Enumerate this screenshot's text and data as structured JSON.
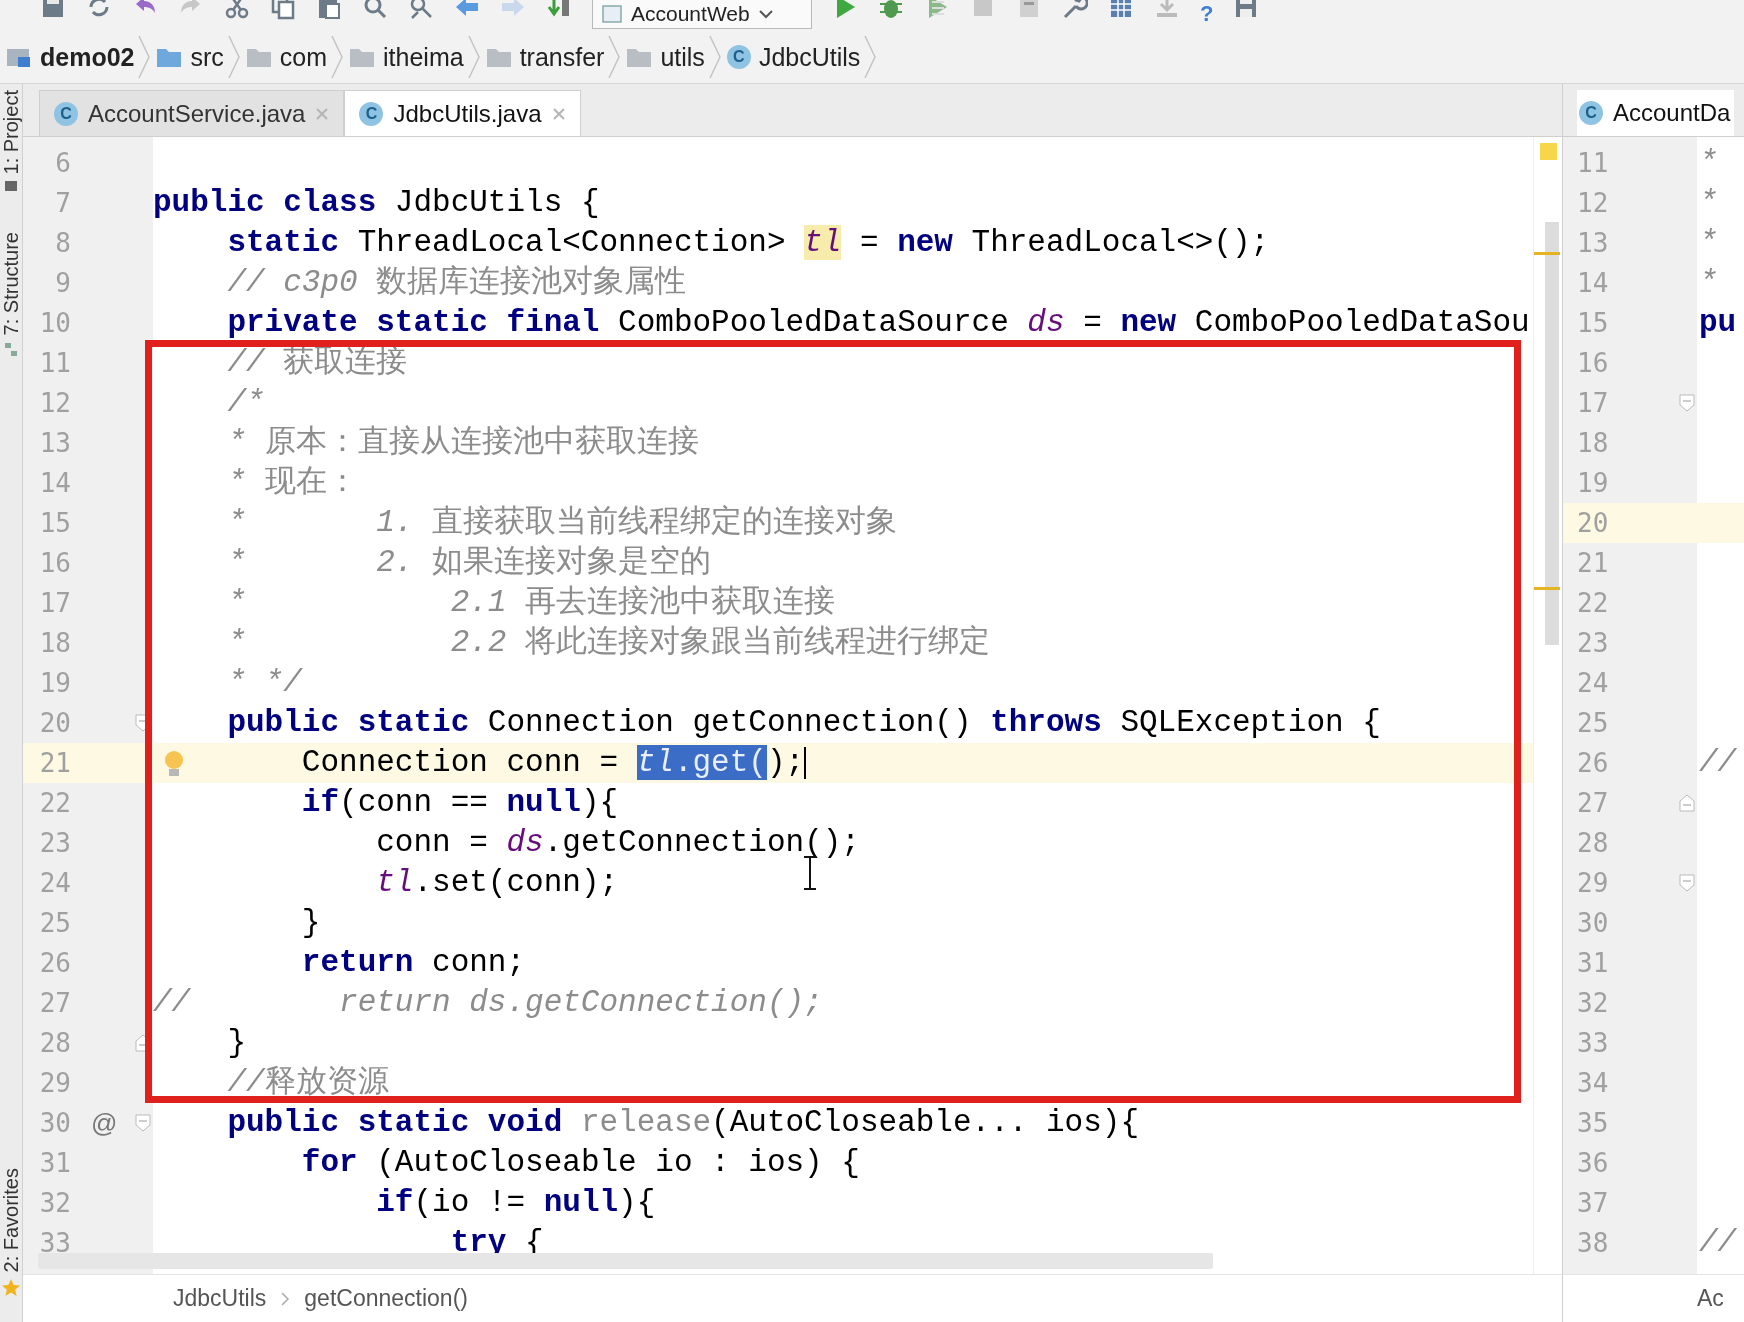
{
  "toolbar": {
    "run_config": "AccountWeb",
    "help": "?"
  },
  "navbar": {
    "items": [
      {
        "label": "demo02",
        "kind": "module"
      },
      {
        "label": "src",
        "kind": "source"
      },
      {
        "label": "com",
        "kind": "folder"
      },
      {
        "label": "itheima",
        "kind": "folder"
      },
      {
        "label": "transfer",
        "kind": "folder"
      },
      {
        "label": "utils",
        "kind": "folder"
      },
      {
        "label": "JdbcUtils",
        "kind": "class",
        "icon_letter": "C"
      }
    ]
  },
  "tool_strip": {
    "labels": [
      "1: Project",
      "7: Structure",
      "2: Favorites"
    ]
  },
  "editor": {
    "tabs": [
      {
        "label": "AccountService.java",
        "icon_letter": "C",
        "selected": false
      },
      {
        "label": "JdbcUtils.java",
        "icon_letter": "C",
        "selected": true
      }
    ],
    "lines": [
      {
        "number": "6",
        "current": false
      },
      {
        "number": "7",
        "current": false,
        "tokens": [
          {
            "text": "public class",
            "kind": "kw"
          },
          {
            "text": " JdbcUtils {",
            "kind": "plain"
          }
        ]
      },
      {
        "number": "8",
        "current": false,
        "tokens": [
          {
            "text": "    static",
            "kind": "kw"
          },
          {
            "text": " ThreadLocal<Connection> ",
            "kind": "plain"
          },
          {
            "text": "tl",
            "kind": "usage"
          },
          {
            "text": " = ",
            "kind": "plain"
          },
          {
            "text": "new",
            "kind": "kw"
          },
          {
            "text": " ThreadLocal<>();",
            "kind": "plain"
          }
        ]
      },
      {
        "number": "9",
        "current": false,
        "tokens": [
          {
            "text": "    // c3p0 ",
            "kind": "comment"
          },
          {
            "text": "数据库连接池对象属性",
            "kind": "remark"
          }
        ]
      },
      {
        "number": "10",
        "current": false,
        "tokens": [
          {
            "text": "    private static final",
            "kind": "kw"
          },
          {
            "text": " ComboPooledDataSource ",
            "kind": "plain"
          },
          {
            "text": "ds",
            "kind": "field"
          },
          {
            "text": " = ",
            "kind": "plain"
          },
          {
            "text": "new",
            "kind": "kw"
          },
          {
            "text": " ComboPooledDataSou",
            "kind": "plain"
          }
        ]
      },
      {
        "number": "11",
        "current": false,
        "tokens": [
          {
            "text": "    // ",
            "kind": "comment"
          },
          {
            "text": "获取连接",
            "kind": "remark"
          }
        ]
      },
      {
        "number": "12",
        "current": false,
        "tokens": [
          {
            "text": "    /*",
            "kind": "comment"
          }
        ]
      },
      {
        "number": "13",
        "current": false,
        "tokens": [
          {
            "text": "    * ",
            "kind": "comment"
          },
          {
            "text": "原本：直接从连接池中获取连接",
            "kind": "remark"
          }
        ]
      },
      {
        "number": "14",
        "current": false,
        "tokens": [
          {
            "text": "    * ",
            "kind": "comment"
          },
          {
            "text": "现在：",
            "kind": "remark"
          }
        ]
      },
      {
        "number": "15",
        "current": false,
        "tokens": [
          {
            "text": "    *       1. ",
            "kind": "comment"
          },
          {
            "text": "直接获取当前线程绑定的连接对象",
            "kind": "remark"
          }
        ]
      },
      {
        "number": "16",
        "current": false,
        "tokens": [
          {
            "text": "    *       2. ",
            "kind": "comment"
          },
          {
            "text": "如果连接对象是空的",
            "kind": "remark"
          }
        ]
      },
      {
        "number": "17",
        "current": false,
        "tokens": [
          {
            "text": "    *           2.1 ",
            "kind": "comment"
          },
          {
            "text": "再去连接池中获取连接",
            "kind": "remark"
          }
        ]
      },
      {
        "number": "18",
        "current": false,
        "tokens": [
          {
            "text": "    *           2.2 ",
            "kind": "comment"
          },
          {
            "text": "将此连接对象跟当前线程进行绑定",
            "kind": "remark"
          }
        ]
      },
      {
        "number": "19",
        "current": false,
        "tokens": [
          {
            "text": "    * */",
            "kind": "comment"
          }
        ]
      },
      {
        "number": "20",
        "current": false,
        "kind": "fold",
        "tokens": [
          {
            "text": "    public static",
            "kind": "kw"
          },
          {
            "text": " Connection getConnection() ",
            "kind": "plain"
          },
          {
            "text": "throws",
            "kind": "kw"
          },
          {
            "text": " SQLException {",
            "kind": "plain"
          }
        ]
      },
      {
        "number": "21",
        "current": true,
        "kind": "bulb",
        "tokens": [
          {
            "text": "        Connection conn = ",
            "kind": "plain"
          },
          {
            "text": "tl",
            "kind": "selfield"
          },
          {
            "text": ".get(",
            "kind": "selplain"
          },
          {
            "text": ");",
            "kind": "plain"
          }
        ]
      },
      {
        "number": "22",
        "current": false,
        "tokens": [
          {
            "text": "        if",
            "kind": "kw"
          },
          {
            "text": "(conn == ",
            "kind": "plain"
          },
          {
            "text": "null",
            "kind": "kw"
          },
          {
            "text": "){",
            "kind": "plain"
          }
        ]
      },
      {
        "number": "23",
        "current": false,
        "tokens": [
          {
            "text": "            conn = ",
            "kind": "plain"
          },
          {
            "text": "ds",
            "kind": "field"
          },
          {
            "text": ".getConnection();",
            "kind": "plain"
          }
        ]
      },
      {
        "number": "24",
        "current": false,
        "tokens": [
          {
            "text": "            tl",
            "kind": "field"
          },
          {
            "text": ".set(conn);",
            "kind": "plain"
          }
        ]
      },
      {
        "number": "25",
        "current": false,
        "tokens": [
          {
            "text": "        }",
            "kind": "plain"
          }
        ]
      },
      {
        "number": "26",
        "current": false,
        "tokens": [
          {
            "text": "        return",
            "kind": "kw"
          },
          {
            "text": " conn;",
            "kind": "plain"
          }
        ]
      },
      {
        "number": "27",
        "current": false,
        "tokens": [
          {
            "text": "//        return ds.getConnection();",
            "kind": "comment"
          }
        ]
      },
      {
        "number": "28",
        "current": false,
        "kind": "foldend",
        "tokens": [
          {
            "text": "    }",
            "kind": "plain"
          }
        ]
      },
      {
        "number": "29",
        "current": false,
        "tokens": [
          {
            "text": "    //",
            "kind": "comment"
          },
          {
            "text": "释放资源",
            "kind": "remark"
          }
        ]
      },
      {
        "number": "30",
        "current": false,
        "kind": "fold",
        "gutter_text": "@",
        "tokens": [
          {
            "text": "    public static void ",
            "kind": "kw"
          },
          {
            "text": "release",
            "kind": "unused"
          },
          {
            "text": "(AutoCloseable... ios){",
            "kind": "plain"
          }
        ]
      },
      {
        "number": "31",
        "current": false,
        "tokens": [
          {
            "text": "        for",
            "kind": "kw"
          },
          {
            "text": " (AutoCloseable io : ios) {",
            "kind": "plain"
          }
        ]
      },
      {
        "number": "32",
        "current": false,
        "tokens": [
          {
            "text": "            if",
            "kind": "kw"
          },
          {
            "text": "(io != ",
            "kind": "plain"
          },
          {
            "text": "null",
            "kind": "kw"
          },
          {
            "text": "){",
            "kind": "plain"
          }
        ]
      },
      {
        "number": "33",
        "current": false,
        "tokens": [
          {
            "text": "                try",
            "kind": "kw"
          },
          {
            "text": " {",
            "kind": "plain"
          }
        ]
      }
    ]
  },
  "side_editor": {
    "tab": {
      "label": "AccountDa",
      "icon_letter": "C"
    },
    "lines": [
      {
        "number": "11",
        "current": false,
        "tokens": [
          {
            "text": "*",
            "kind": "comment"
          }
        ]
      },
      {
        "number": "12",
        "current": false,
        "tokens": [
          {
            "text": "*",
            "kind": "comment"
          }
        ]
      },
      {
        "number": "13",
        "current": false,
        "tokens": [
          {
            "text": "*",
            "kind": "comment"
          }
        ]
      },
      {
        "number": "14",
        "current": false,
        "tokens": [
          {
            "text": "*",
            "kind": "comment"
          }
        ]
      },
      {
        "number": "15",
        "current": false,
        "tokens": [
          {
            "text": "pu",
            "kind": "kw"
          }
        ]
      },
      {
        "number": "16",
        "current": false
      },
      {
        "number": "17",
        "current": false,
        "kind": "fold"
      },
      {
        "number": "18",
        "current": false
      },
      {
        "number": "19",
        "current": false
      },
      {
        "number": "20",
        "current": true
      },
      {
        "number": "21",
        "current": false
      },
      {
        "number": "22",
        "current": false
      },
      {
        "number": "23",
        "current": false
      },
      {
        "number": "24",
        "current": false
      },
      {
        "number": "25",
        "current": false
      },
      {
        "number": "26",
        "current": false,
        "tokens": [
          {
            "text": "//",
            "kind": "comment"
          }
        ]
      },
      {
        "number": "27",
        "current": false,
        "kind": "foldend"
      },
      {
        "number": "28",
        "current": false
      },
      {
        "number": "29",
        "current": false,
        "kind": "fold"
      },
      {
        "number": "30",
        "current": false
      },
      {
        "number": "31",
        "current": false
      },
      {
        "number": "32",
        "current": false
      },
      {
        "number": "33",
        "current": false
      },
      {
        "number": "34",
        "current": false
      },
      {
        "number": "35",
        "current": false
      },
      {
        "number": "36",
        "current": false
      },
      {
        "number": "37",
        "current": false
      },
      {
        "number": "38",
        "current": false,
        "tokens": [
          {
            "text": "//",
            "kind": "comment"
          }
        ]
      }
    ]
  },
  "status_bar": {
    "breadcrumbs": [
      "JdbcUtils",
      "getConnection()"
    ],
    "right_text": "Ac"
  }
}
